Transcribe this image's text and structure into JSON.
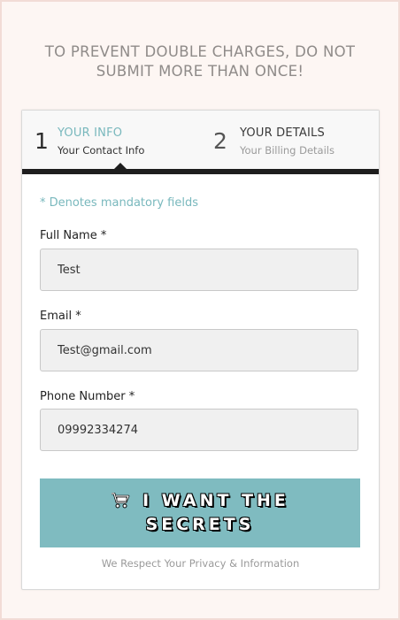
{
  "warning": {
    "line1": "TO PREVENT DOUBLE CHARGES, DO NOT",
    "line2": "SUBMIT MORE THAN ONCE!"
  },
  "steps": [
    {
      "number": "1",
      "title": "YOUR INFO",
      "subtitle": "Your Contact Info",
      "active": true
    },
    {
      "number": "2",
      "title": "YOUR DETAILS",
      "subtitle": "Your Billing Details",
      "active": false
    }
  ],
  "form": {
    "mandatory_note": "* Denotes mandatory fields",
    "fields": [
      {
        "label": "Full Name *",
        "value": "Test"
      },
      {
        "label": "Email *",
        "value": "Test@gmail.com"
      },
      {
        "label": "Phone Number *",
        "value": "09992334274"
      }
    ],
    "submit": {
      "line1": "I WANT THE",
      "line2": "SECRETS",
      "icon": "cart-icon"
    },
    "privacy": "We Respect Your Privacy & Information"
  },
  "colors": {
    "accent": "#7fbbc0",
    "step_active": "#79b8bd",
    "page_bg": "#fdf6f3"
  }
}
